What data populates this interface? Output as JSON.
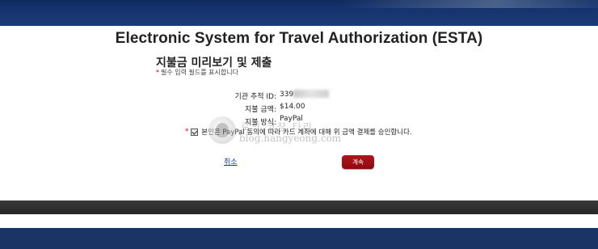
{
  "page": {
    "title": "Electronic System for Travel Authorization (ESTA)"
  },
  "form": {
    "section_title": "지불금 미리보기 및 제출",
    "required_note_star": "*",
    "required_note": "필수 입력 필드를 표시합니다",
    "agency_tracking_label": "기관 추적 ID:",
    "agency_tracking_value": "339",
    "amount_label": "지불 금액:",
    "amount_value": "$14.00",
    "method_label": "지불 방식:",
    "method_value": "PayPal",
    "consent_star": "*",
    "consent_text": "본인은 PayPal 동의에 따라 카드 계좌에 대해 위 금액 결제를 승인합니다.",
    "consent_checked": true
  },
  "actions": {
    "cancel_label": "취소",
    "continue_label": "계속"
  },
  "watermark": {
    "korean": "로의 코장 타리",
    "url": "blog.hangyeong.com"
  },
  "colors": {
    "header_blue": "#1b3b77",
    "button_red": "#a01016",
    "link_blue": "#1a3a8a",
    "required_red": "#c00000"
  }
}
